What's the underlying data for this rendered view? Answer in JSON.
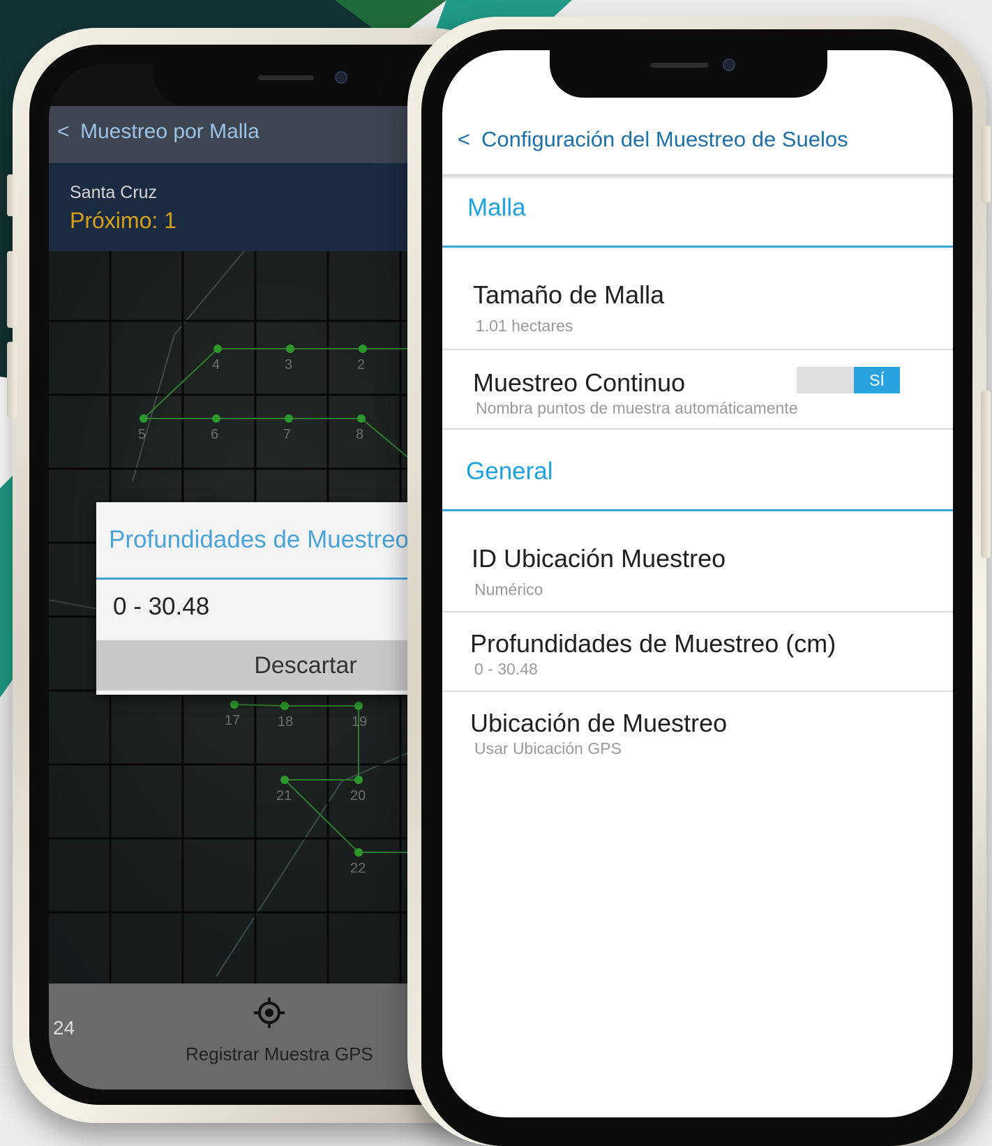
{
  "back_phone": {
    "header": {
      "title": "Muestreo por Malla"
    },
    "subheader": {
      "location": "Santa Cruz",
      "next_label": "Próximo: 1"
    },
    "map": {
      "point_labels": [
        "4",
        "3",
        "2",
        "5",
        "6",
        "7",
        "8",
        "17",
        "18",
        "19",
        "21",
        "20",
        "22"
      ]
    },
    "dialog": {
      "title": "Profundidades de Muestreo",
      "value": "0 - 30.48",
      "dismiss_label": "Descartar"
    },
    "bottom_bar": {
      "count": "24",
      "record_label": "Registrar Muestra GPS"
    }
  },
  "front_phone": {
    "header": {
      "title": "Configuración del Muestreo de Suelos"
    },
    "sections": [
      {
        "title": "Malla",
        "items": [
          {
            "title": "Tamaño de Malla",
            "subtitle": "1.01 hectares"
          },
          {
            "title": "Muestreo Continuo",
            "subtitle": "Nombra puntos de muestra automáticamente",
            "toggle_label": "SÍ",
            "toggle_on": true
          }
        ]
      },
      {
        "title": "General",
        "items": [
          {
            "title": "ID Ubicación Muestreo",
            "subtitle": "Numérico"
          },
          {
            "title": "Profundidades de Muestreo (cm)",
            "subtitle": "0 - 30.48"
          },
          {
            "title": "Ubicación de Muestreo",
            "subtitle": "Usar Ubicación GPS"
          }
        ]
      }
    ]
  },
  "colors": {
    "accent_blue": "#1ea2dc",
    "header_blue": "#1d6fa8",
    "bg_dark_teal": "#123233",
    "bg_green": "#1f6b3a",
    "bg_teal": "#1f9a86"
  }
}
